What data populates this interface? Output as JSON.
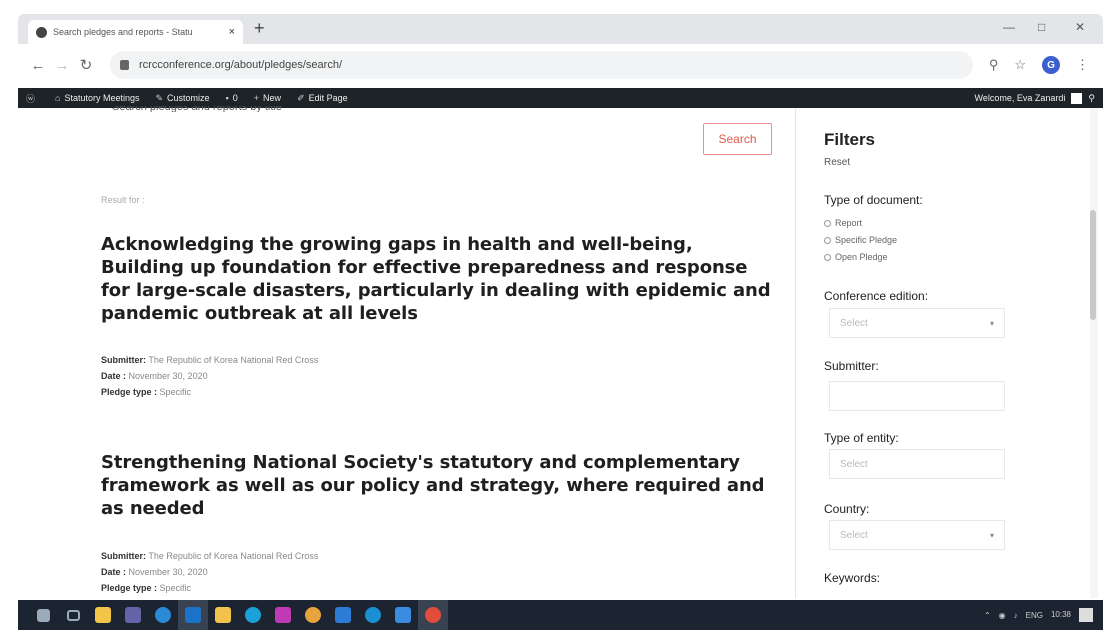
{
  "browser": {
    "tab_title": "Search pledges and reports - Statu",
    "tab_close": "×",
    "new_tab": "+",
    "url": "rcrcconference.org/about/pledges/search/",
    "profile_initial": "G",
    "window_controls": [
      "—",
      "□",
      "✕"
    ]
  },
  "admin_bar": {
    "items": [
      "Statutory Meetings",
      "Customize",
      "0",
      "New",
      "Edit Page"
    ],
    "greeting": "Welcome, Eva Zanardi"
  },
  "content": {
    "clipped_heading": "Search pledges and reports by title",
    "search_label": "Search",
    "result_for": "Result for :",
    "results": [
      {
        "title": "Acknowledging the growing gaps in health and well-being, Building up foundation for effective preparedness and response for large-scale disasters, particularly in dealing with epidemic and pandemic outbreak at all levels",
        "submitter_label": "Submitter:",
        "submitter": "The Republic of Korea National Red Cross",
        "date_label": "Date :",
        "date": "November 30, 2020",
        "type_label": "Pledge type :",
        "type": "Specific"
      },
      {
        "title": "Strengthening National Society's statutory and complementary framework as well as our policy and strategy, where required and as needed",
        "submitter_label": "Submitter:",
        "submitter": "The Republic of Korea National Red Cross",
        "date_label": "Date :",
        "date": "November 30, 2020",
        "type_label": "Pledge type :",
        "type": "Specific"
      }
    ]
  },
  "filters": {
    "title": "Filters",
    "reset": "Reset",
    "type_of_document": "Type of document:",
    "doc_options": [
      "Report",
      "Specific Pledge",
      "Open Pledge"
    ],
    "conference_edition": "Conference edition:",
    "conference_placeholder": "Select",
    "submitter": "Submitter:",
    "type_of_entity": "Type of entity:",
    "entity_placeholder": "Select",
    "country": "Country:",
    "country_placeholder": "Select",
    "keywords": "Keywords:"
  },
  "taskbar": {
    "lang": "ENG",
    "time": "10:38",
    "date": ""
  }
}
